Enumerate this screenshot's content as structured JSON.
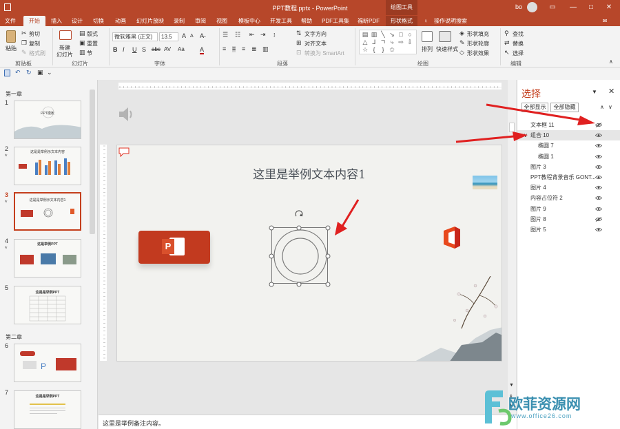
{
  "titlebar": {
    "title": "PPT教程.pptx  -  PowerPoint",
    "context_group": "绘图工具",
    "user": "bo",
    "minimize": "—",
    "restore": "❐",
    "maximize": "□",
    "close": "✕"
  },
  "tabs": [
    "文件",
    "开始",
    "插入",
    "设计",
    "切换",
    "动画",
    "幻灯片放映",
    "录制",
    "审阅",
    "视图",
    "模板中心",
    "开发工具",
    "帮助",
    "PDF工具集",
    "福昕PDF",
    "形状格式",
    "操作说明搜索"
  ],
  "ribbon": {
    "clipboard": {
      "paste": "粘贴",
      "cut": "剪切",
      "copy": "复制",
      "format_painter": "格式刷",
      "group": "剪贴板"
    },
    "slides": {
      "new_slide": "新建",
      "new_slide2": "幻灯片",
      "layout": "版式",
      "reset": "重置",
      "section": "节",
      "group": "幻灯片"
    },
    "font": {
      "font_name": "微软雅黑 (正文)",
      "font_size": "13.5",
      "group": "字体",
      "buttons": [
        "B",
        "I",
        "U",
        "S",
        "abc",
        "AV",
        "Aa",
        "A"
      ]
    },
    "paragraph": {
      "text_direction": "文字方向",
      "align_text": "对齐文本",
      "smartart": "转换为 SmartArt",
      "group": "段落"
    },
    "drawing": {
      "arrange": "排列",
      "quick_styles": "快速样式",
      "fill": "形状填充",
      "outline": "形状轮廓",
      "effects": "形状效果",
      "group": "绘图"
    },
    "editing": {
      "find": "查找",
      "replace": "替换",
      "select": "选择",
      "group": "编辑"
    }
  },
  "thumbnails": {
    "sections": [
      "第一章",
      "第二章"
    ],
    "slides": [
      {
        "num": "1",
        "starred": false,
        "title": "PPT模板"
      },
      {
        "num": "2",
        "starred": true,
        "title": "这是是举例示文本内容"
      },
      {
        "num": "3",
        "starred": true,
        "title": "这是是举例示文本内容1"
      },
      {
        "num": "4",
        "starred": true,
        "title": "这是举例PPT"
      },
      {
        "num": "5",
        "starred": false,
        "title": "这是是举例PPT"
      },
      {
        "num": "6",
        "starred": false,
        "title": ""
      },
      {
        "num": "7",
        "starred": false,
        "title": "这是是举例PPT"
      }
    ]
  },
  "slide": {
    "title": "这里是举例文本内容1"
  },
  "notes": {
    "text": "这里是举例备注内容。"
  },
  "selection_pane": {
    "title": "选择",
    "show_all": "全部显示",
    "hide_all": "全部隐藏",
    "items": [
      {
        "label": "文本框 11",
        "indent": 0,
        "visible": false,
        "selected": false,
        "expander": ""
      },
      {
        "label": "组合 10",
        "indent": 0,
        "visible": true,
        "selected": true,
        "expander": "∨"
      },
      {
        "label": "椭圆 7",
        "indent": 1,
        "visible": true,
        "selected": false,
        "expander": ""
      },
      {
        "label": "椭圆 1",
        "indent": 1,
        "visible": true,
        "selected": false,
        "expander": ""
      },
      {
        "label": "图片 3",
        "indent": 0,
        "visible": true,
        "selected": false,
        "expander": ""
      },
      {
        "label": "PPT教程背景音乐 GONT...",
        "indent": 0,
        "visible": true,
        "selected": false,
        "expander": ""
      },
      {
        "label": "图片 4",
        "indent": 0,
        "visible": true,
        "selected": false,
        "expander": ""
      },
      {
        "label": "内容占位符 2",
        "indent": 0,
        "visible": true,
        "selected": false,
        "expander": ""
      },
      {
        "label": "图片 9",
        "indent": 0,
        "visible": true,
        "selected": false,
        "expander": ""
      },
      {
        "label": "图片 8",
        "indent": 0,
        "visible": false,
        "selected": false,
        "expander": ""
      },
      {
        "label": "图片 5",
        "indent": 0,
        "visible": true,
        "selected": false,
        "expander": ""
      }
    ]
  },
  "watermark": {
    "brand": "欧菲资源网",
    "url": "www.office26.com"
  },
  "colors": {
    "accent": "#b7472a",
    "context": "#9c3b22",
    "annotation_arrow": "#e02020"
  }
}
